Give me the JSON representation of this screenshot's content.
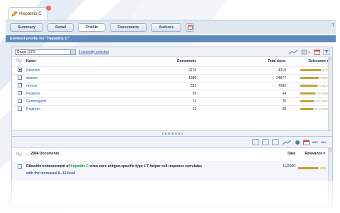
{
  "tab": {
    "title": "Hepatitis C"
  },
  "nav": {
    "buttons": [
      "Summary",
      "Detail",
      "Profile",
      "Documents",
      "Authors"
    ],
    "active": "Profile",
    "right_label": "T"
  },
  "header": {
    "title": "Element profile for \"Hepatitis C\""
  },
  "drugs_panel": {
    "select_value": "Drugs (376)",
    "link_text": "1 bioentity selected",
    "columns": [
      "Name",
      "Documents",
      "Total docs.",
      "Relevance"
    ],
    "rows": [
      {
        "name": "Ribavirin",
        "documents": "2176",
        "total": "4219",
        "relevance": "97%",
        "checked": true,
        "rel": 0.97
      },
      {
        "name": "alanine",
        "documents": "1680",
        "total": "24877",
        "relevance": "88%",
        "checked": false,
        "rel": 0.88
      },
      {
        "name": "retrove",
        "documents": "531",
        "total": "7082",
        "relevance": "81%",
        "checked": false,
        "rel": 0.81
      },
      {
        "name": "Pegasys",
        "documents": "25",
        "total": "64",
        "relevance": "69%",
        "checked": false,
        "rel": 0.69
      },
      {
        "name": "Gammagard",
        "documents": "12",
        "total": "25",
        "relevance": "65%",
        "checked": false,
        "rel": 0.65
      },
      {
        "name": "Peginron",
        "documents": "11",
        "total": "28",
        "relevance": "60%",
        "checked": false,
        "rel": 0.6
      }
    ]
  },
  "docs_panel": {
    "count_label": "← 2966 Documents",
    "col_date": "Date",
    "col_relevance": "Relevance",
    "toolbar_labels": {
      "any": "ANY",
      "all": "ALL"
    },
    "doc": {
      "pre": "Ribavirin enhancement of ",
      "highlight": "hepatitis C",
      "post": " virus core antigen-specific type 1 T helper cell response correlates",
      "line2": "with the increased IL-12 level",
      "date": "11/2000",
      "relevance": "93%",
      "rel": 0.93
    }
  },
  "colors": {
    "accent": "#5f88bd",
    "relevance_bar": "#c1a232",
    "link": "#2d57a7"
  }
}
